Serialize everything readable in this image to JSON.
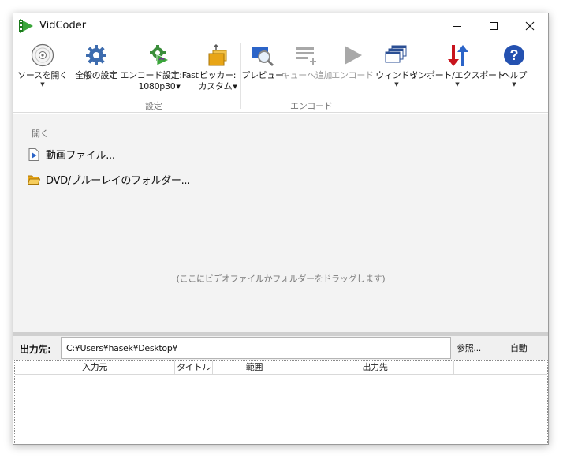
{
  "window": {
    "title": "VidCoder"
  },
  "ribbon": {
    "open_source": {
      "label": "ソースを開く"
    },
    "general_settings": {
      "label": "全般の設定"
    },
    "encode_settings": {
      "label": "エンコード設定:Fast",
      "label2": "1080p30"
    },
    "picker": {
      "label": "ピッカー:",
      "label2": "カスタム"
    },
    "preview": {
      "label": "プレビュー"
    },
    "add_to_queue": {
      "label": "キューへ追加"
    },
    "encode": {
      "label": "エンコード"
    },
    "window_menu": {
      "label": "ウィンドウ"
    },
    "import_export": {
      "label": "インポート/エクスポート"
    },
    "help": {
      "label": "ヘルプ"
    },
    "group_settings": "設定",
    "group_encode": "エンコード"
  },
  "open_panel": {
    "header": "開く",
    "video_file": "動画ファイル...",
    "dvd_folder": "DVD/ブルーレイのフォルダー...",
    "drag_hint": "(ここにビデオファイルかフォルダーをドラッグします)"
  },
  "output": {
    "label": "出力先:",
    "path": "C:¥Users¥hasek¥Desktop¥",
    "browse": "参照...",
    "auto": "自動"
  },
  "queue": {
    "columns": [
      "入力元",
      "タイトル",
      "範囲",
      "出力先",
      ""
    ]
  },
  "colors": {
    "accent_blue": "#2b64c8",
    "gear_blue": "#3d6cae",
    "folder_yellow": "#e8a516",
    "help_blue": "#2451b0",
    "arrow_red": "#c8141e",
    "disabled_gray": "#a8a8a8"
  }
}
